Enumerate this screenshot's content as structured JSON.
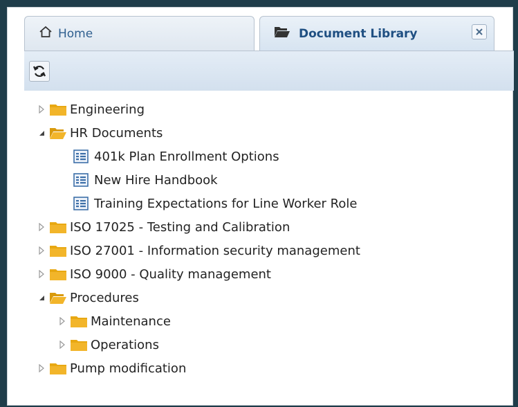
{
  "tabs": [
    {
      "label": "Home",
      "icon": "home-icon",
      "active": false
    },
    {
      "label": "Document Library",
      "icon": "folder-open-icon",
      "active": true
    }
  ],
  "toolbar": {
    "refresh_icon": "refresh-icon"
  },
  "tree": [
    {
      "label": "Engineering",
      "type": "folder",
      "expanded": false,
      "depth": 0
    },
    {
      "label": "HR Documents",
      "type": "folder",
      "expanded": true,
      "depth": 0
    },
    {
      "label": "401k Plan Enrollment Options",
      "type": "document",
      "depth": 1
    },
    {
      "label": "New Hire Handbook",
      "type": "document",
      "depth": 1
    },
    {
      "label": "Training Expectations for Line Worker Role",
      "type": "document",
      "depth": 1
    },
    {
      "label": "ISO 17025 - Testing and Calibration",
      "type": "folder",
      "expanded": false,
      "depth": 0
    },
    {
      "label": "ISO 27001 - Information security management",
      "type": "folder",
      "expanded": false,
      "depth": 0
    },
    {
      "label": "ISO 9000 - Quality management",
      "type": "folder",
      "expanded": false,
      "depth": 0
    },
    {
      "label": "Procedures",
      "type": "folder",
      "expanded": true,
      "depth": 0
    },
    {
      "label": "Maintenance",
      "type": "folder",
      "expanded": false,
      "depth": 1
    },
    {
      "label": "Operations",
      "type": "folder",
      "expanded": false,
      "depth": 1
    },
    {
      "label": "Pump modification",
      "type": "folder",
      "expanded": false,
      "depth": 0
    }
  ],
  "colors": {
    "folder": "#e8a812",
    "accent": "#1f4f82"
  }
}
